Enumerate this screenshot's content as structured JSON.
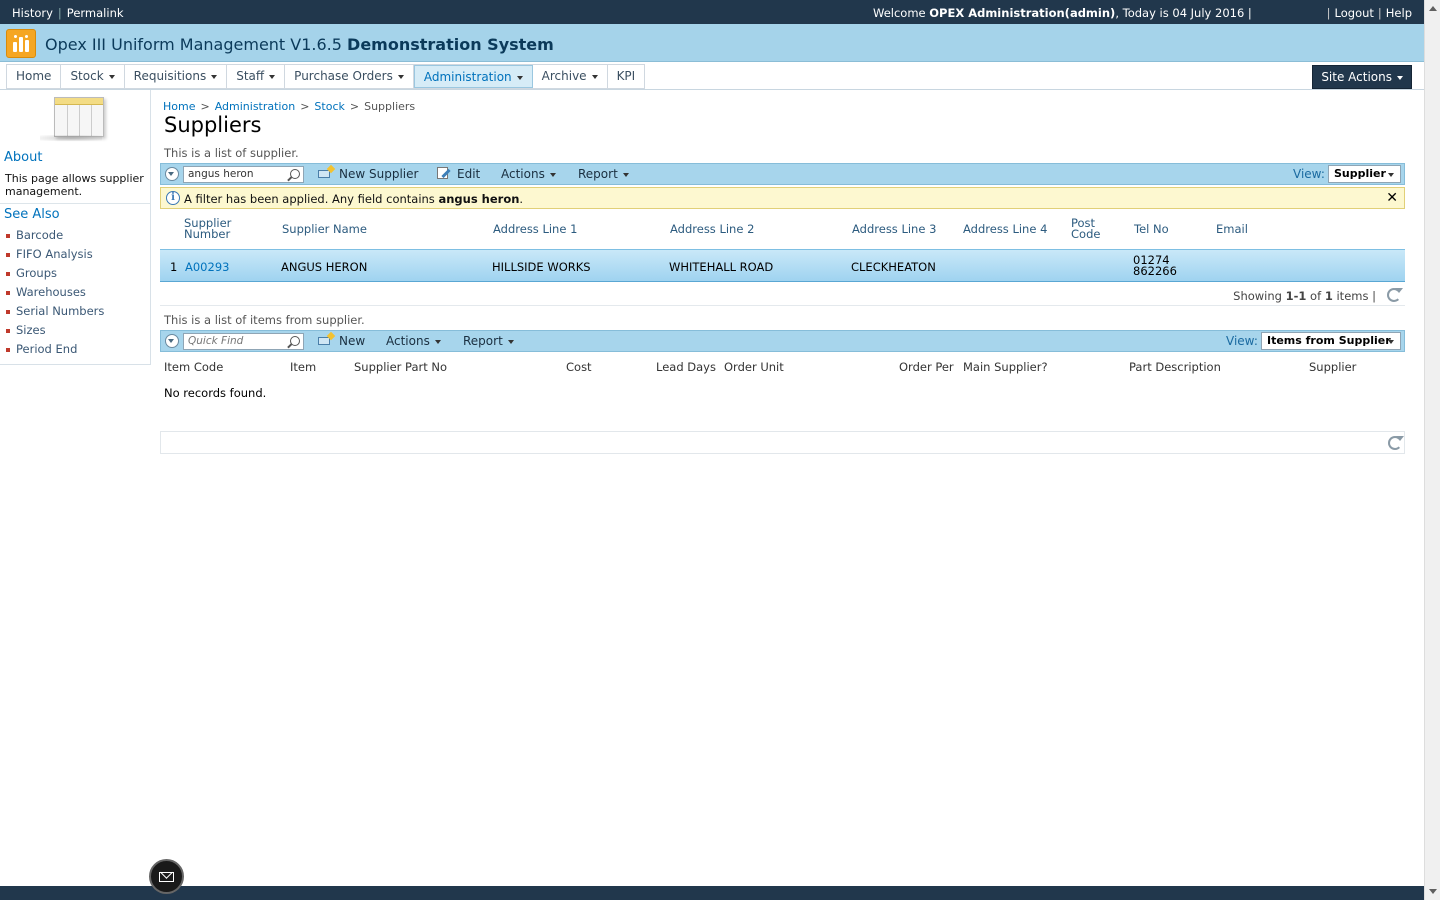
{
  "topbar": {
    "history": "History",
    "permalink": "Permalink",
    "welcome_prefix": "Welcome ",
    "user": "OPEX Administration(admin)",
    "date_text": ", Today is 04 July 2016 |",
    "logout": "Logout",
    "help": "Help"
  },
  "site": {
    "title": "Opex III Uniform Management V1.6.5 ",
    "subtitle": "Demonstration System"
  },
  "nav": {
    "items": [
      {
        "label": "Home",
        "dropdown": false
      },
      {
        "label": "Stock",
        "dropdown": true
      },
      {
        "label": "Requisitions",
        "dropdown": true
      },
      {
        "label": "Staff",
        "dropdown": true
      },
      {
        "label": "Purchase Orders",
        "dropdown": true
      },
      {
        "label": "Administration",
        "dropdown": true,
        "active": true
      },
      {
        "label": "Archive",
        "dropdown": true
      },
      {
        "label": "KPI",
        "dropdown": false
      }
    ],
    "site_actions": "Site Actions"
  },
  "left": {
    "about_heading": "About",
    "about_text": "This page allows supplier management.",
    "see_also_heading": "See Also",
    "links": [
      "Barcode",
      "FIFO Analysis",
      "Groups",
      "Warehouses",
      "Serial Numbers",
      "Sizes",
      "Period End"
    ]
  },
  "breadcrumb": {
    "home": "Home",
    "admin": "Administration",
    "stock": "Stock",
    "current": "Suppliers"
  },
  "page": {
    "title": "Suppliers",
    "suppliers_desc": "This is a list of supplier.",
    "items_desc": "This is a list of items from supplier."
  },
  "suppliers_toolbar": {
    "search_value": "angus heron",
    "new_label": "New Supplier",
    "edit_label": "Edit",
    "actions_label": "Actions",
    "report_label": "Report",
    "view_label": "View:",
    "view_value": "Supplier"
  },
  "filter": {
    "text": "A filter has been applied. Any field contains ",
    "term": "angus heron",
    "suffix": "."
  },
  "suppliers_table": {
    "headers": [
      "Supplier\nNumber",
      "Supplier Name",
      "Address Line 1",
      "Address Line 2",
      "Address Line 3",
      "Address Line 4",
      "Post\nCode",
      "Tel No",
      "Email"
    ],
    "rows": [
      {
        "index": "1",
        "number": "A00293",
        "name": "ANGUS HERON",
        "addr1": "HILLSIDE WORKS",
        "addr2": "WHITEHALL ROAD",
        "addr3": "CLECKHEATON",
        "addr4": "",
        "postcode": "",
        "tel": "01274\n862266",
        "email": ""
      }
    ],
    "paging_prefix": "Showing ",
    "paging_range": "1-1",
    "paging_mid": " of ",
    "paging_total": "1",
    "paging_suffix": " items |"
  },
  "items_toolbar": {
    "search_placeholder": "Quick Find",
    "new_label": "New",
    "actions_label": "Actions",
    "report_label": "Report",
    "view_label": "View:",
    "view_value": "Items from Supplier"
  },
  "items_table": {
    "headers": [
      "Item Code",
      "Item",
      "Supplier Part No",
      "Cost",
      "Lead Days",
      "Order Unit",
      "Order Per",
      "Main Supplier?",
      "Part Description",
      "Supplier"
    ],
    "empty_text": "No records found."
  }
}
